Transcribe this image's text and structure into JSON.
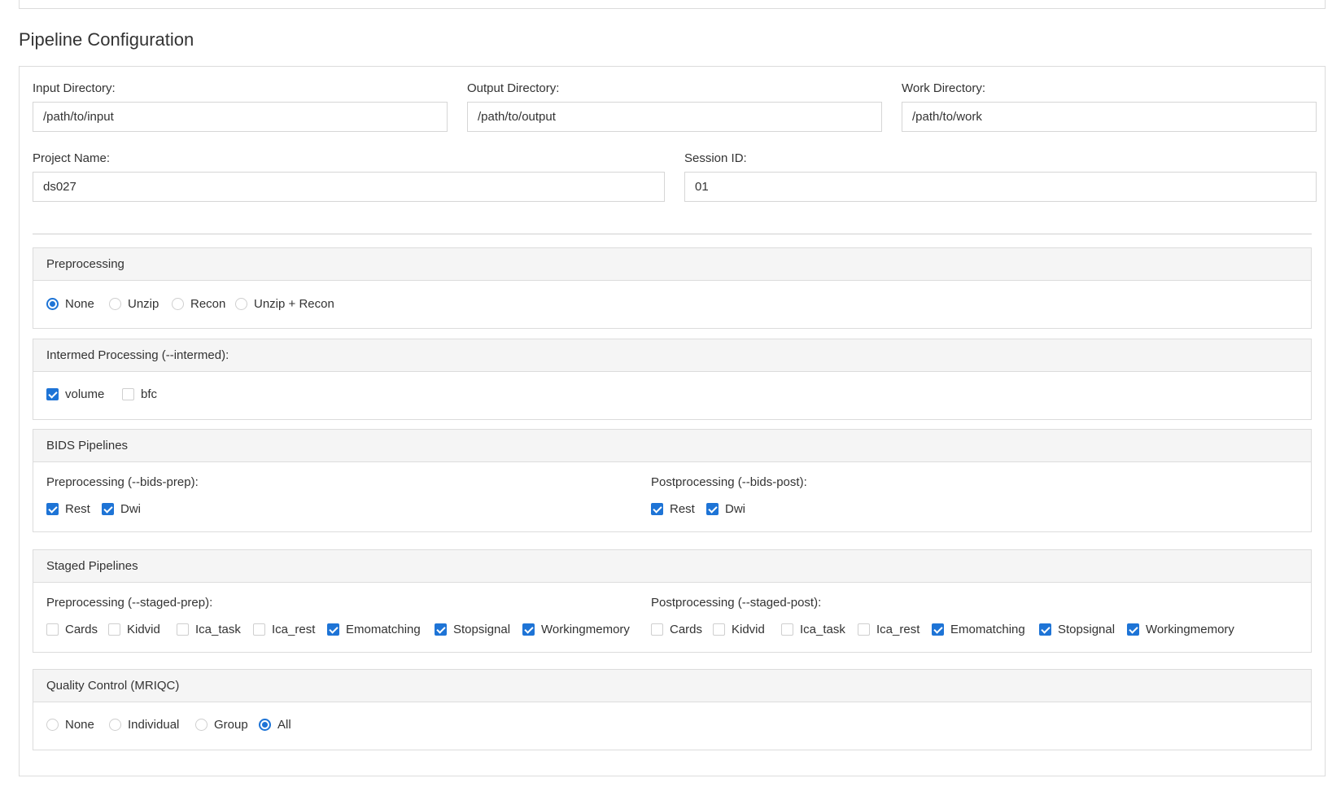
{
  "page": {
    "title": "Pipeline Configuration"
  },
  "fields": {
    "input_dir": {
      "label": "Input Directory:",
      "value": "/path/to/input"
    },
    "output_dir": {
      "label": "Output Directory:",
      "value": "/path/to/output"
    },
    "work_dir": {
      "label": "Work Directory:",
      "value": "/path/to/work"
    },
    "project_name": {
      "label": "Project Name:",
      "value": "ds027"
    },
    "session_id": {
      "label": "Session ID:",
      "value": "01"
    }
  },
  "preprocessing": {
    "title": "Preprocessing",
    "options": [
      {
        "label": "None",
        "selected": true
      },
      {
        "label": "Unzip",
        "selected": false
      },
      {
        "label": "Recon",
        "selected": false
      },
      {
        "label": "Unzip + Recon",
        "selected": false
      }
    ]
  },
  "intermed": {
    "title": "Intermed Processing (--intermed):",
    "options": [
      {
        "label": "volume",
        "checked": true
      },
      {
        "label": "bfc",
        "checked": false
      }
    ]
  },
  "bids": {
    "title": "BIDS Pipelines",
    "prep_label": "Preprocessing (--bids-prep):",
    "post_label": "Postprocessing (--bids-post):",
    "prep": [
      {
        "label": "Rest",
        "checked": true
      },
      {
        "label": "Dwi",
        "checked": true
      }
    ],
    "post": [
      {
        "label": "Rest",
        "checked": true
      },
      {
        "label": "Dwi",
        "checked": true
      }
    ]
  },
  "staged": {
    "title": "Staged Pipelines",
    "prep_label": "Preprocessing (--staged-prep):",
    "post_label": "Postprocessing (--staged-post):",
    "prep": [
      {
        "label": "Cards",
        "checked": false
      },
      {
        "label": "Kidvid",
        "checked": false
      },
      {
        "label": "Ica_task",
        "checked": false
      },
      {
        "label": "Ica_rest",
        "checked": false
      },
      {
        "label": "Emomatching",
        "checked": true
      },
      {
        "label": "Stopsignal",
        "checked": true
      },
      {
        "label": "Workingmemory",
        "checked": true
      }
    ],
    "post": [
      {
        "label": "Cards",
        "checked": false
      },
      {
        "label": "Kidvid",
        "checked": false
      },
      {
        "label": "Ica_task",
        "checked": false
      },
      {
        "label": "Ica_rest",
        "checked": false
      },
      {
        "label": "Emomatching",
        "checked": true
      },
      {
        "label": "Stopsignal",
        "checked": true
      },
      {
        "label": "Workingmemory",
        "checked": true
      }
    ]
  },
  "mriqc": {
    "title": "Quality Control (MRIQC)",
    "options": [
      {
        "label": "None",
        "selected": false
      },
      {
        "label": "Individual",
        "selected": false
      },
      {
        "label": "Group",
        "selected": false
      },
      {
        "label": "All",
        "selected": true
      }
    ]
  }
}
